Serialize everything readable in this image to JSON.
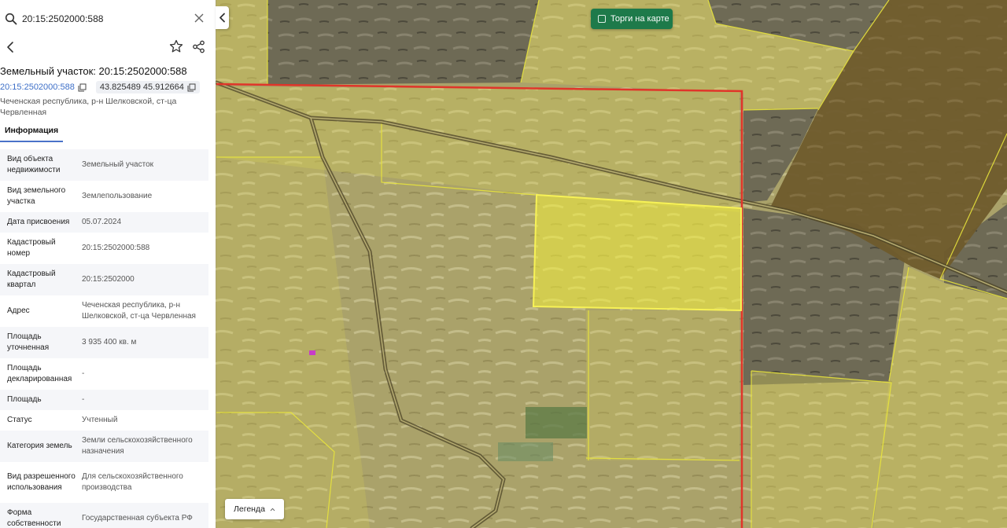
{
  "search": {
    "value": "20:15:2502000:588"
  },
  "header": {
    "title": "Земельный участок: 20:15:2502000:588",
    "cadastral_link": "20:15:2502000:588",
    "coordinates": "43.825489 45.912664",
    "address": "Чеченская республика, р-н Шелковской, ст-ца Червленная"
  },
  "tabs": [
    {
      "label": "Информация",
      "active": true
    }
  ],
  "info_rows": [
    {
      "key": "Вид объекта недвижимости",
      "value": "Земельный участок"
    },
    {
      "key": "Вид земельного участка",
      "value": "Землепользование"
    },
    {
      "key": "Дата присвоения",
      "value": "05.07.2024"
    },
    {
      "key": "Кадастровый номер",
      "value": "20:15:2502000:588"
    },
    {
      "key": "Кадастровый квартал",
      "value": "20:15:2502000"
    },
    {
      "key": "Адрес",
      "value": "Чеченская республика, р-н Шелковской, ст-ца Червленная"
    },
    {
      "key": "Площадь уточненная",
      "value": "3 935 400 кв. м"
    },
    {
      "key": "Площадь декларированная",
      "value": "-"
    },
    {
      "key": "Площадь",
      "value": "-"
    },
    {
      "key": "Статус",
      "value": "Учтенный"
    },
    {
      "key": "Категория земель",
      "value": "Земли сельскохозяйственного назначения"
    },
    {
      "key": "Вид разрешенного использования",
      "value": "Для сельскохозяйственного производства"
    },
    {
      "key": "Форма собственности",
      "value": "Государственная субъекта РФ"
    }
  ],
  "map": {
    "auction_toggle_label": "Торги на карте",
    "auction_toggle_checked": false,
    "legend_label": "Легенда"
  },
  "icons": {
    "search": "search-icon",
    "clear": "close-icon",
    "back": "chevron-left-icon",
    "favorite": "star-icon",
    "share": "share-icon",
    "copy": "copy-icon",
    "collapse": "chevron-left-icon",
    "legend": "chevron-up-icon"
  },
  "colors": {
    "accent_link": "#3d6fc8",
    "tab_underline": "#4a72c9",
    "auction_button": "#1e7a4a",
    "parcel_highlight": "#f2ee3a",
    "parcel_border": "#e8e43c",
    "boundary_red": "#e0352a"
  }
}
